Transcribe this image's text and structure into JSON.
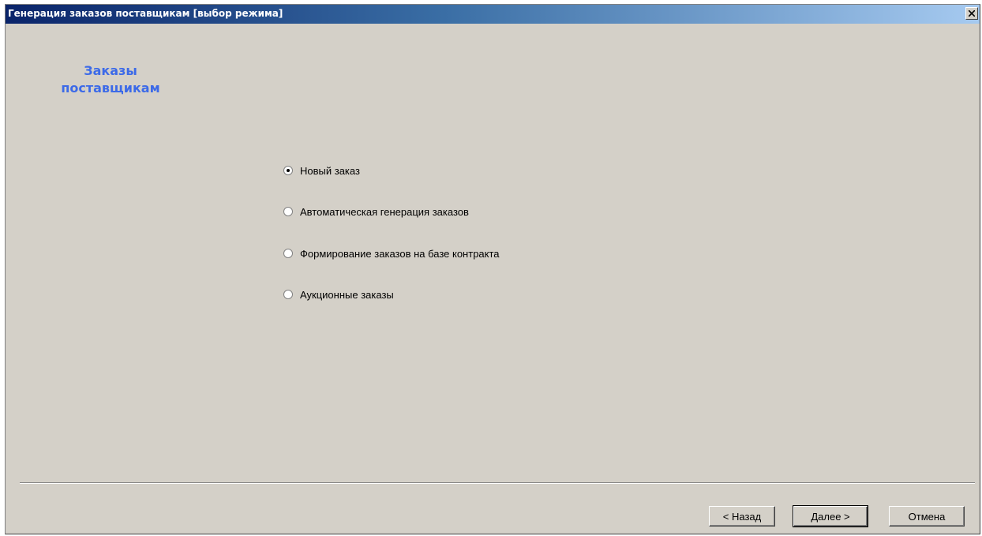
{
  "window": {
    "title": "Генерация заказов поставщикам [выбор режима]",
    "close_icon": "close-icon"
  },
  "heading": {
    "line1": "Заказы",
    "line2": "поставщикам",
    "color": "#3c6ae8"
  },
  "options": [
    {
      "label": "Новый заказ",
      "selected": true
    },
    {
      "label": "Автоматическая генерация заказов",
      "selected": false
    },
    {
      "label": "Формирование заказов на базе контракта",
      "selected": false
    },
    {
      "label": "Аукционные заказы",
      "selected": false
    }
  ],
  "buttons": {
    "back": "< Назад",
    "next": "Далее >",
    "cancel": "Отмена"
  },
  "colors": {
    "dialog_background": "#d4d0c8",
    "titlebar_start": "#0a246a",
    "titlebar_end": "#a6caf0"
  }
}
